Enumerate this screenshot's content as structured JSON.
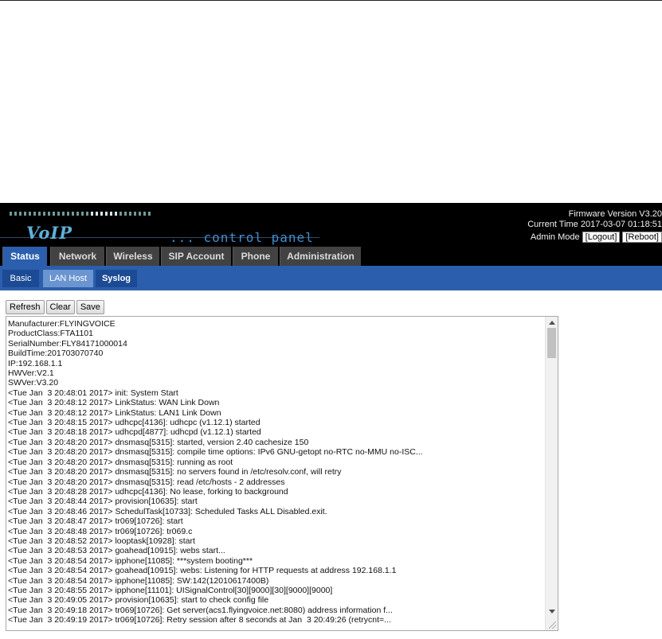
{
  "header": {
    "logo_text": "VoIP",
    "tagline": "... control panel",
    "firmware_text": "Firmware Version V3.20",
    "current_time_text": "Current Time 2017-03-07 01:18:51",
    "admin_mode_label": "Admin Mode",
    "logout_label": "[Logout]",
    "reboot_label": "[Reboot]"
  },
  "main_tabs": [
    {
      "label": "Status",
      "active": true
    },
    {
      "label": "Network",
      "active": false
    },
    {
      "label": "Wireless",
      "active": false
    },
    {
      "label": "SIP Account",
      "active": false
    },
    {
      "label": "Phone",
      "active": false
    },
    {
      "label": "Administration",
      "active": false
    }
  ],
  "sub_tabs": [
    {
      "label": "Basic",
      "active": false
    },
    {
      "label": "LAN Host",
      "active": true
    },
    {
      "label": "Syslog",
      "active": false
    }
  ],
  "toolbar": {
    "refresh_label": "Refresh",
    "clear_label": "Clear",
    "save_label": "Save"
  },
  "log_lines": [
    "Manufacturer:FLYINGVOICE",
    "ProductClass:FTA1101",
    "SerialNumber:FLY84171000014",
    "BuildTime:201703070740",
    "IP:192.168.1.1",
    "HWVer:V2.1",
    "SWVer:V3.20",
    "<Tue Jan  3 20:48:01 2017> init: System Start",
    "<Tue Jan  3 20:48:12 2017> LinkStatus: WAN Link Down",
    "<Tue Jan  3 20:48:12 2017> LinkStatus: LAN1 Link Down",
    "<Tue Jan  3 20:48:15 2017> udhcpc[4136]: udhcpc (v1.12.1) started",
    "<Tue Jan  3 20:48:18 2017> udhcpd[4877]: udhcpd (v1.12.1) started",
    "<Tue Jan  3 20:48:20 2017> dnsmasq[5315]: started, version 2.40 cachesize 150",
    "<Tue Jan  3 20:48:20 2017> dnsmasq[5315]: compile time options: IPv6 GNU-getopt no-RTC no-MMU no-ISC...",
    "<Tue Jan  3 20:48:20 2017> dnsmasq[5315]: running as root",
    "<Tue Jan  3 20:48:20 2017> dnsmasq[5315]: no servers found in /etc/resolv.conf, will retry",
    "<Tue Jan  3 20:48:20 2017> dnsmasq[5315]: read /etc/hosts - 2 addresses",
    "<Tue Jan  3 20:48:28 2017> udhcpc[4136]: No lease, forking to background",
    "<Tue Jan  3 20:48:44 2017> provision[10635]: start",
    "<Tue Jan  3 20:48:46 2017> SchedulTask[10733]: Scheduled Tasks ALL Disabled.exit.",
    "<Tue Jan  3 20:48:47 2017> tr069[10726]: start",
    "<Tue Jan  3 20:48:48 2017> tr069[10726]: tr069.c",
    "<Tue Jan  3 20:48:52 2017> looptask[10928]: start",
    "<Tue Jan  3 20:48:53 2017> goahead[10915]: webs start...",
    "<Tue Jan  3 20:48:54 2017> ipphone[11085]: ***system booting***",
    "<Tue Jan  3 20:48:54 2017> goahead[10915]: webs: Listening for HTTP requests at address 192.168.1.1",
    "<Tue Jan  3 20:48:54 2017> ipphone[11085]: SW:142(12010617400B)",
    "<Tue Jan  3 20:48:55 2017> ipphone[11101]: UISignalControl[30][9000][30][9000][9000]",
    "<Tue Jan  3 20:49:05 2017> provision[10635]: start to check config file",
    "<Tue Jan  3 20:49:18 2017> tr069[10726]: Get server(acs1.flyingvoice.net:8080) address information f...",
    "<Tue Jan  3 20:49:19 2017> tr069[10726]: Retry session after 8 seconds at Jan  3 20:49:26 (retrycnt=..."
  ],
  "colors": {
    "header_bg": "#000000",
    "tab_active": "#2b5fad",
    "tab_inactive": "#424242",
    "subbar_bg": "#2b5fad",
    "subtab_inactive": "#1c4a94",
    "subtab_active": "#6b95d0"
  }
}
